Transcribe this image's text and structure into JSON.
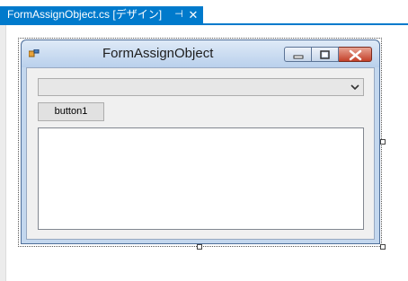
{
  "tab": {
    "title": "FormAssignObject.cs [デザイン]",
    "pin_icon": "pin-icon",
    "close_icon": "close-icon"
  },
  "form": {
    "title": "FormAssignObject",
    "app_icon": "form-icon",
    "caption_buttons": [
      "minimize-icon",
      "maximize-icon",
      "close-icon"
    ]
  },
  "controls": {
    "combo_value": "",
    "combo_arrow_icon": "chevron-down-icon",
    "button1_label": "button1",
    "listbox_items": []
  },
  "colors": {
    "tab_accent": "#007acc",
    "titlebar": "#c3d7ee",
    "close_button": "#c4412a",
    "client": "#f0f0f0"
  }
}
